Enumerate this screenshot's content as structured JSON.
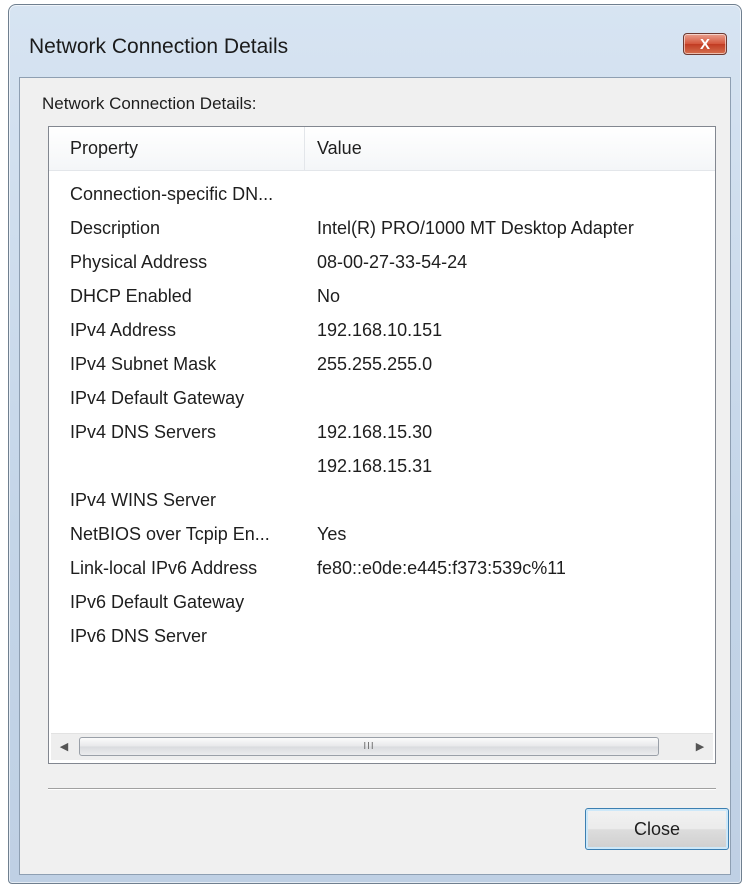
{
  "window": {
    "title": "Network Connection Details",
    "close_glyph": "X"
  },
  "group_label": "Network Connection Details:",
  "table": {
    "columns": [
      "Property",
      "Value"
    ],
    "rows": [
      {
        "property": "Connection-specific DN...",
        "value": ""
      },
      {
        "property": "Description",
        "value": "Intel(R) PRO/1000 MT Desktop Adapter"
      },
      {
        "property": "Physical Address",
        "value": "08-00-27-33-54-24"
      },
      {
        "property": "DHCP Enabled",
        "value": "No"
      },
      {
        "property": "IPv4 Address",
        "value": "192.168.10.151"
      },
      {
        "property": "IPv4 Subnet Mask",
        "value": "255.255.255.0"
      },
      {
        "property": "IPv4 Default Gateway",
        "value": ""
      },
      {
        "property": "IPv4 DNS Servers",
        "value": "192.168.15.30"
      },
      {
        "property": "",
        "value": "192.168.15.31"
      },
      {
        "property": "IPv4 WINS Server",
        "value": ""
      },
      {
        "property": "NetBIOS over Tcpip En...",
        "value": "Yes"
      },
      {
        "property": "Link-local IPv6 Address",
        "value": "fe80::e0de:e445:f373:539c%11"
      },
      {
        "property": "IPv6 Default Gateway",
        "value": ""
      },
      {
        "property": "IPv6 DNS Server",
        "value": ""
      }
    ]
  },
  "scrollbar": {
    "left_arrow": "◀",
    "right_arrow": "▶",
    "grip": "III"
  },
  "buttons": {
    "close_label": "Close"
  },
  "colors": {
    "window_frame": "#c4d5e8",
    "close_x_red": "#c13b23",
    "default_button_border": "#3c7fb1"
  },
  "icons": [
    "close-icon",
    "scroll-left-arrow-icon",
    "scroll-right-arrow-icon",
    "scroll-grip-icon"
  ]
}
